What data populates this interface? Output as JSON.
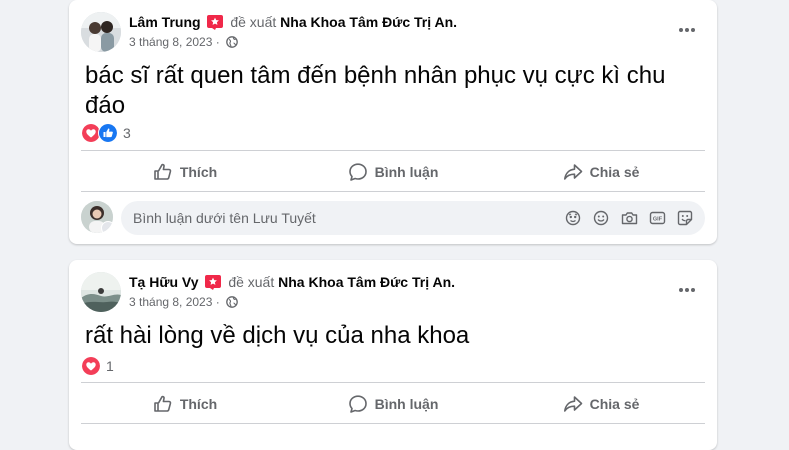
{
  "colors": {
    "background": "#f0f2f5",
    "card": "#ffffff",
    "secondary_text": "#65676b",
    "love": "#f33e58",
    "like": "#1877f2",
    "recommend_badge": "#f02849"
  },
  "actions": {
    "like_label": "Thích",
    "comment_label": "Bình luận",
    "share_label": "Chia sẻ"
  },
  "posts": [
    {
      "author": "Lâm Trung",
      "verb": "đề xuất",
      "page": "Nha Khoa Tâm Đức Trị An",
      "page_suffix": ".",
      "date": "3 tháng 8, 2023",
      "date_separator": "·",
      "audience_icon": "globe-icon",
      "text": "bác sĩ rất quen tâm đến bệnh nhân phục vụ cực kì chu đáo",
      "reactions": [
        "love-reaction-icon",
        "like-reaction-icon"
      ],
      "reaction_count": "3",
      "comment_placeholder": "Bình luận dưới tên Lưu Tuyết"
    },
    {
      "author": "Tạ Hữu Vy",
      "verb": "đề xuất",
      "page": "Nha Khoa Tâm Đức Trị An",
      "page_suffix": ".",
      "date": "3 tháng 8, 2023",
      "date_separator": "·",
      "audience_icon": "globe-icon",
      "text": "rất hài lòng về dịch vụ của nha khoa",
      "reactions": [
        "love-reaction-icon"
      ],
      "reaction_count": "1"
    }
  ]
}
